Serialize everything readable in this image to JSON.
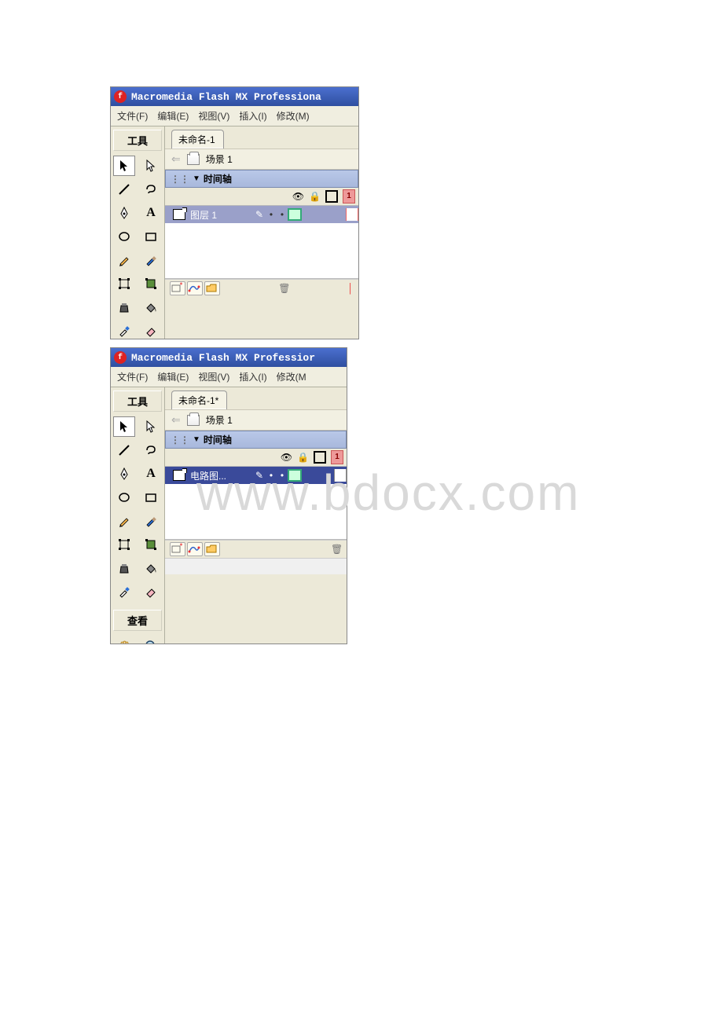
{
  "watermark": "www.bdocx.com",
  "app": {
    "title1": "Macromedia Flash MX Professiona",
    "title2": "Macromedia Flash MX Professior"
  },
  "menu": {
    "file": "文件(F)",
    "edit": "编辑(E)",
    "view": "视图(V)",
    "insert": "插入(I)",
    "modify": "修改(M)",
    "modify_short": "修改(M"
  },
  "tools": {
    "header": "工具",
    "view_header": "查看"
  },
  "win1": {
    "tab": "未命名-1",
    "scene": "场景 1",
    "timeline": "时间轴",
    "layer": "图层 1",
    "frame1": "1"
  },
  "win2": {
    "tab": "未命名-1*",
    "scene": "场景 1",
    "timeline": "时间轴",
    "layer": "电路图...",
    "frame1": "1"
  }
}
